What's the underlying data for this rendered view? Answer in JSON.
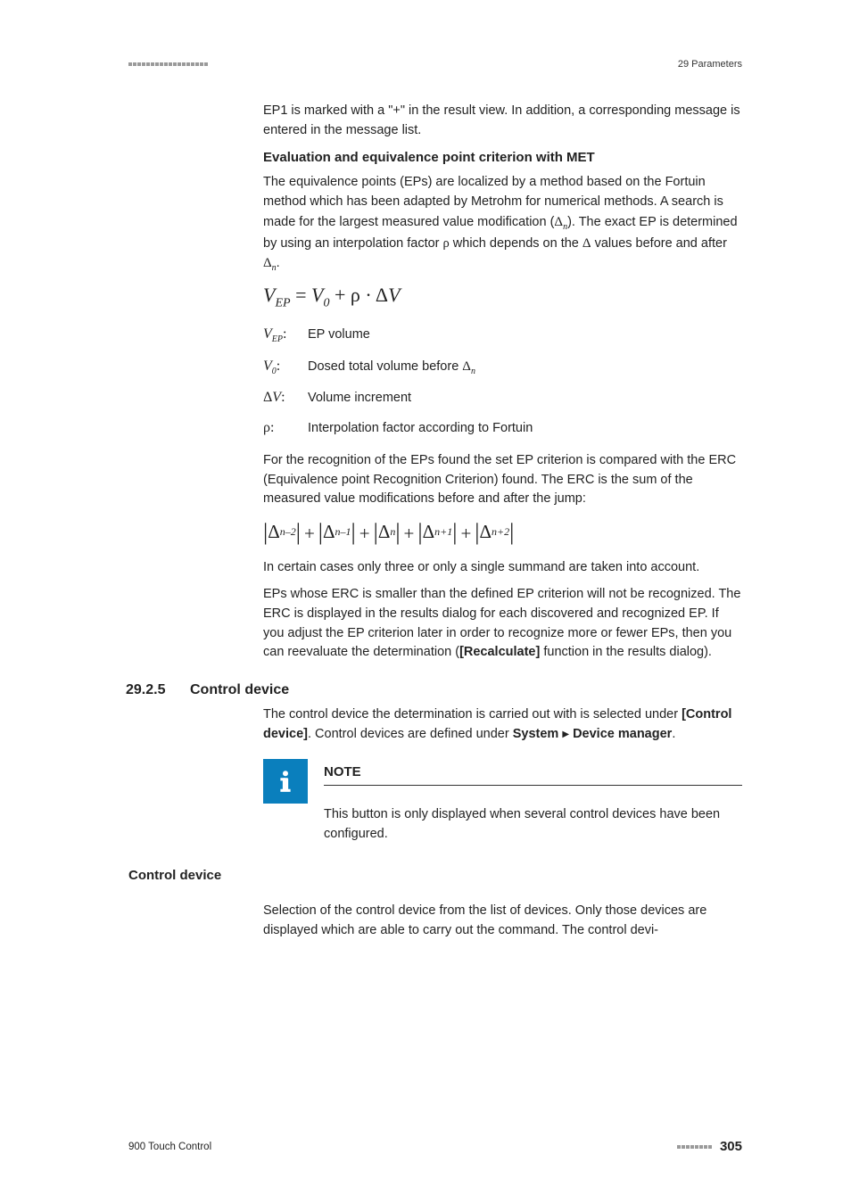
{
  "header": {
    "chapter": "29 Parameters"
  },
  "intro_para": "EP1 is marked with a \"+\" in the result view. In addition, a corresponding message is entered in the message list.",
  "heading1": "Evaluation and equivalence point criterion with MET",
  "eval_para": "The equivalence points (EPs) are localized by a method based on the Fortuin method which has been adapted by Metrohm for numerical methods. A search is made for the largest measured value modification (",
  "eval_para_mid": "). The exact EP is determined by using an interpolation factor ",
  "eval_para_mid2": " which depends on the ",
  "eval_para_mid3": " values before and after ",
  "definitions": [
    {
      "text": "EP volume"
    },
    {
      "text": "Dosed total volume before "
    },
    {
      "text": "Volume increment"
    },
    {
      "text": "Interpolation factor according to Fortuin"
    }
  ],
  "rec_para": "For the recognition of the EPs found the set EP criterion is compared with the ERC (Equivalence point Recognition Criterion) found. The ERC is the sum of the measured value modifications before and after the jump:",
  "certain_para": "In certain cases only three or only a single summand are taken into account.",
  "erc_para1": "EPs whose ERC is smaller than the defined EP criterion will not be recognized. The ERC is displayed in the results dialog for each discovered and recognized EP. If you adjust the EP criterion later in order to recognize more or fewer EPs, then you can reevaluate the determination (",
  "erc_bold": "[Recalculate]",
  "erc_para2": " function in the results dialog).",
  "section": {
    "number": "29.2.5",
    "title": "Control device"
  },
  "control_para1": "The control device the determination is carried out with is selected under ",
  "control_bold1": "[Control device]",
  "control_para2": ". Control devices are defined under ",
  "control_bold2": "System",
  "control_bold3": "Device manager",
  "control_para3": ".",
  "note": {
    "title": "NOTE",
    "body": "This button is only displayed when several control devices have been configured."
  },
  "subhead": "Control device",
  "sub_para": "Selection of the control device from the list of devices. Only those devices are displayed which are able to carry out the command. The control devi-",
  "footer": {
    "left": "900 Touch Control",
    "page": "305"
  }
}
